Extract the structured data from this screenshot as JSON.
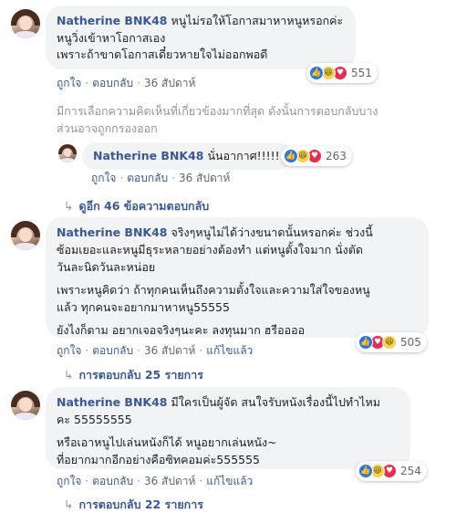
{
  "comments": [
    {
      "author": "Natherine BNK48",
      "lines": [
        "หนูไม่รอให้โอกาสมาหาหนูหรอกค่ะ",
        "หนูวิ่งเข้าหาโอกาสเอง",
        "เพราะถ้าขาดโอกาสเดี๋ยวหายใจไม่ออกพอดี"
      ],
      "reaction_count": "551",
      "actions": {
        "like": "ถูกใจ",
        "reply": "ตอบกลับ",
        "time": "36 สัปดาห์"
      }
    }
  ],
  "notice": {
    "line1": "มีการเลือกความคิดเห็นที่เกี่ยวข้องมากที่สุด ดังนั้นการตอบกลับบาง",
    "line2": "ส่วนอาจถูกกรองออก"
  },
  "reply": {
    "author": "Natherine BNK48",
    "text": "นั่นอากาศ!!!!!",
    "reaction_count": "263",
    "actions": {
      "like": "ถูกใจ",
      "reply": "ตอบกลับ",
      "time": "36 สัปดาห์"
    }
  },
  "more_replies_1": "ดูอีก 46 ข้อความตอบกลับ",
  "comment2": {
    "author": "Natherine BNK48",
    "line1": "จริงๆหนูไม่ได้ว่างขนาดนั้นหรอกค่ะ ช่วงนี้",
    "line2": "ซ้อมเยอะและหนูมีธุระหลายอย่างต้องทำ แต่หนูตั้งใจมาก นั่งตัด",
    "line3": "วันละนิดวันละหน่อย",
    "line4": "เพราะหนูคิดว่า ถ้าทุกคนเห็นถึงความตั้งใจและความใส่ใจของหนู",
    "line5": "แล้ว ทุกคนจะอยากมาหาหนู55555",
    "line6": "ยังไงก็ตาม อยากเจอจริงๆนะคะ ลงทุนมาก ฮรืออออ",
    "reaction_count": "505",
    "actions": {
      "like": "ถูกใจ",
      "reply": "ตอบกลับ",
      "time": "36 สัปดาห์",
      "edited": "แก้ไขแล้ว"
    }
  },
  "more_replies_2": "การตอบกลับ 25 รายการ",
  "comment3": {
    "author": "Natherine BNK48",
    "line1": "มีใครเป็นผู้จัด สนใจรับหนังเรื่องนี้ไปทำไหม",
    "line2": "คะ 55555555",
    "line3": "หรือเอาหนูไปเล่นหนังก็ได้ หนูอยากเล่นหนัง~",
    "line4": "ที่อยากมากอีกอย่างคือซิทคอมค่ะ555555",
    "reaction_count": "254",
    "actions": {
      "like": "ถูกใจ",
      "reply": "ตอบกลับ",
      "time": "36 สัปดาห์",
      "edited": "แก้ไขแล้ว"
    }
  },
  "more_replies_3": "การตอบกลับ 22 รายการ",
  "icons": {
    "like": "like-reaction-icon",
    "haha": "haha-reaction-icon",
    "love": "love-reaction-icon",
    "reply_arrow": "reply-arrow-icon"
  }
}
